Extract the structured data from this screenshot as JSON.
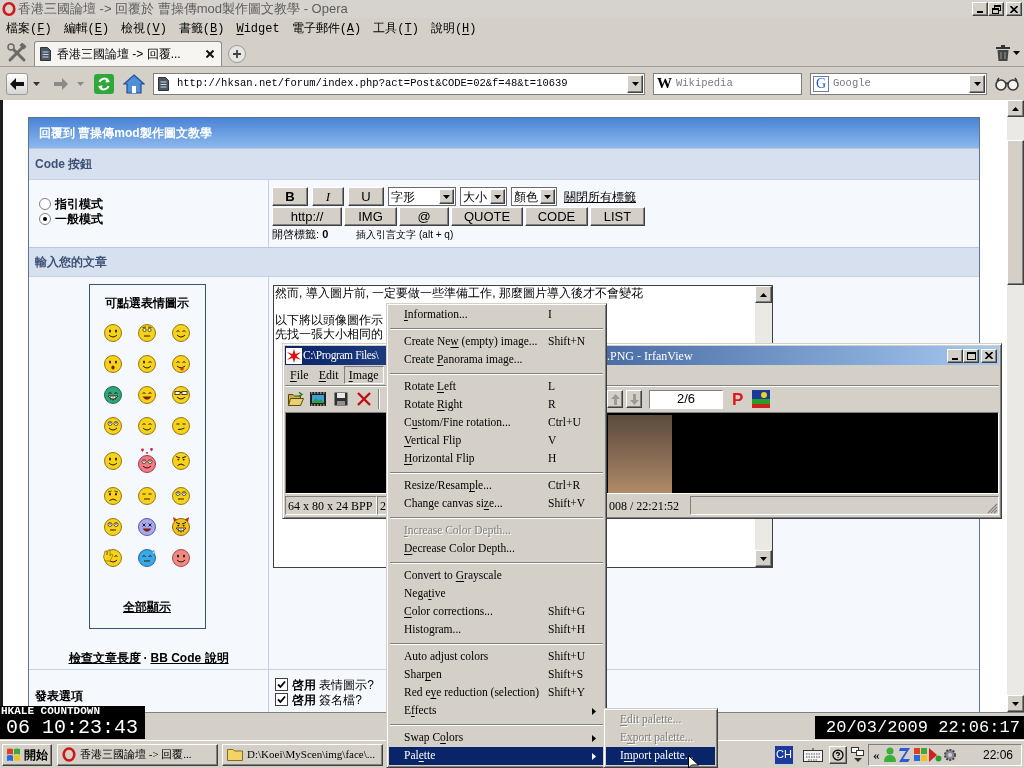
{
  "window": {
    "title": "香港三國論壇 -> 回覆於 曹操傳mod製作圖文教學 - Opera"
  },
  "menu_bar": [
    {
      "pre": "檔案(",
      "accel": "F",
      "post": ")"
    },
    {
      "pre": "編輯(",
      "accel": "E",
      "post": ")"
    },
    {
      "pre": "檢視(",
      "accel": "V",
      "post": ")"
    },
    {
      "pre": "書籤(",
      "accel": "B",
      "post": ")"
    },
    {
      "accel": "W",
      "post": "idget"
    },
    {
      "pre": "電子郵件(",
      "accel": "A",
      "post": ")"
    },
    {
      "pre": "工具(",
      "accel": "T",
      "post": ")"
    },
    {
      "pre": "說明(",
      "accel": "H",
      "post": ")"
    }
  ],
  "tabs": [
    {
      "label": "香港三國論壇 -> 回覆...",
      "selected": true
    }
  ],
  "address_bar": {
    "url": "http://hksan.net/forum/index.php?act=Post&CODE=02&f=48&t=10639"
  },
  "search_fields": [
    {
      "logo": "W",
      "placeholder": "Wikipedia",
      "kind": "plain"
    },
    {
      "logo": "G",
      "placeholder": "Google",
      "kind": "dropdown"
    }
  ],
  "form": {
    "header": "回覆到 曹操傳mod製作圖文教學",
    "code_section": {
      "title": "Code 按鈕",
      "modes": [
        {
          "label": "指引模式",
          "selected": false
        },
        {
          "label": "一般模式",
          "selected": true
        }
      ],
      "format_buttons": [
        {
          "label": "B",
          "kind": "bold"
        },
        {
          "label": "I",
          "kind": "italic"
        },
        {
          "label": "U",
          "kind": "underline"
        }
      ],
      "selects": [
        {
          "value": "字形"
        },
        {
          "value": "大小"
        },
        {
          "value": "顏色"
        }
      ],
      "close_tags_link": "關閉所有標籤",
      "tag_buttons": [
        "http://",
        "IMG",
        "@",
        "QUOTE",
        "CODE",
        "LIST"
      ],
      "open_tags": "開啓標籤: **0**",
      "quote_hint": "插入引言文字 (alt + q)"
    },
    "post_section": {
      "title": "輸入您的文章",
      "emoticons_title": "可點選表情圖示",
      "show_all_link": "全部顯示",
      "help_links": [
        "檢查文章長度",
        "BB Code 說明"
      ],
      "link_separator": "·",
      "message_paragraphs": [
        [
          "然而, 導入圖片前, 一定要做一些準備工作, 那麼圖片導入後才不會變花"
        ],
        [
          "以下將以頭像圖作示",
          "先找一張大小相同的"
        ]
      ]
    },
    "options_section": {
      "title": "發表選項",
      "checkboxes": [
        {
          "label": "**啓用** 表情圖示?",
          "checked": true
        },
        {
          "label": "**啓用** 簽名檔?",
          "checked": true
        }
      ]
    }
  },
  "irfanview": {
    "title_start": "C:\\Program Files\\",
    "title_end": ".PNG - IrfanView",
    "menu": [
      {
        "accel": "F",
        "post": "ile",
        "selected": false
      },
      {
        "accel": "E",
        "post": "dit",
        "selected": false
      },
      {
        "accel": "I",
        "post": "mage",
        "selected": true
      }
    ],
    "page_field": "2/6",
    "properties_button": "P",
    "status": [
      "64 x 80 x 24 BPP",
      "2",
      "008 / 22:21:52"
    ]
  },
  "image_menu": {
    "items": [
      {
        "kind": "item",
        "accel": "I",
        "post": "nformation...",
        "shortcut": "I",
        "disabled": false,
        "selected": false
      },
      {
        "kind": "separator"
      },
      {
        "kind": "item",
        "pre": "Create Ne",
        "accel": "w",
        "post": " (empty) image...",
        "shortcut": "Shift+N",
        "disabled": false,
        "selected": false
      },
      {
        "kind": "item",
        "pre": "Create ",
        "accel": "P",
        "post": "anorama image...",
        "disabled": false,
        "selected": false
      },
      {
        "kind": "separator"
      },
      {
        "kind": "item",
        "pre": "Rotate ",
        "accel": "L",
        "post": "eft",
        "shortcut": "L",
        "disabled": false,
        "selected": false
      },
      {
        "kind": "item",
        "pre": "Rotate ",
        "accel": "R",
        "post": "ight",
        "shortcut": "R",
        "disabled": false,
        "selected": false
      },
      {
        "kind": "item",
        "pre": "C",
        "accel": "u",
        "post": "stom/Fine rotation...",
        "shortcut": "Ctrl+U",
        "disabled": false,
        "selected": false
      },
      {
        "kind": "item",
        "accel": "V",
        "post": "ertical Flip",
        "shortcut": "V",
        "disabled": false,
        "selected": false
      },
      {
        "kind": "item",
        "accel": "H",
        "post": "orizontal Flip",
        "shortcut": "H",
        "disabled": false,
        "selected": false
      },
      {
        "kind": "separator"
      },
      {
        "kind": "item",
        "pre": "Resize/Resam",
        "accel": "p",
        "post": "le...",
        "shortcut": "Ctrl+R",
        "disabled": false,
        "selected": false
      },
      {
        "kind": "item",
        "pre": "Change canvas si",
        "accel": "z",
        "post": "e...",
        "shortcut": "Shift+V",
        "disabled": false,
        "selected": false
      },
      {
        "kind": "separator"
      },
      {
        "kind": "item",
        "accel": "I",
        "post": "ncrease Color Depth...",
        "disabled": true,
        "selected": false
      },
      {
        "kind": "item",
        "accel": "D",
        "post": "ecrease Color Depth...",
        "disabled": false,
        "selected": false
      },
      {
        "kind": "separator"
      },
      {
        "kind": "item",
        "pre": "Convert to ",
        "accel": "G",
        "post": "rayscale",
        "disabled": false,
        "selected": false
      },
      {
        "kind": "item",
        "pre": "Nega",
        "accel": "t",
        "post": "ive",
        "disabled": false,
        "selected": false
      },
      {
        "kind": "item",
        "accel": "C",
        "post": "olor corrections...",
        "shortcut": "Shift+G",
        "disabled": false,
        "selected": false
      },
      {
        "kind": "item",
        "pre": "Histogram...",
        "shortcut": "Shift+H",
        "disabled": false,
        "selected": false
      },
      {
        "kind": "separator"
      },
      {
        "kind": "item",
        "pre": "Auto adjust colors",
        "shortcut": "Shift+U",
        "disabled": false,
        "selected": false
      },
      {
        "kind": "item",
        "pre": "Shar",
        "accel": "p",
        "post": "en",
        "shortcut": "Shift+S",
        "disabled": false,
        "selected": false
      },
      {
        "kind": "item",
        "pre": "Red e",
        "accel": "y",
        "post": "e reduction (selection)",
        "shortcut": "Shift+Y",
        "disabled": false,
        "selected": false
      },
      {
        "kind": "submenu",
        "pre": "E",
        "accel": "f",
        "post": "fects",
        "disabled": false,
        "selected": false
      },
      {
        "kind": "separator"
      },
      {
        "kind": "submenu",
        "pre": "Swap C",
        "accel": "o",
        "post": "lors",
        "disabled": false,
        "selected": false
      },
      {
        "kind": "submenu",
        "pre": "Pal",
        "accel": "e",
        "post": "tte",
        "disabled": false,
        "selected": true
      }
    ]
  },
  "palette_submenu": {
    "items": [
      {
        "kind": "item",
        "accel": "E",
        "post": "dit palette...",
        "disabled": true,
        "selected": false
      },
      {
        "kind": "item",
        "pre": "E",
        "accel": "x",
        "post": "port palette...",
        "disabled": true,
        "selected": false
      },
      {
        "kind": "item",
        "pre": "I",
        "accel": "m",
        "post": "port palette...",
        "disabled": false,
        "selected": true
      }
    ]
  },
  "countdown_widget": {
    "title": "HKALE COUNTDOWN",
    "value": "06 10:23:43"
  },
  "clock_widget": {
    "value": "20/03/2009 22:06:17"
  },
  "taskbar": {
    "start": "開始",
    "tasks": [
      {
        "label": "香港三國論壇 -> 回覆...",
        "kind": "browser"
      },
      {
        "label": "D:\\Koei\\MyScen\\img\\face\\...",
        "kind": "folder"
      }
    ],
    "language": "CH",
    "tray_toggle": "«",
    "clock": "22:06"
  }
}
